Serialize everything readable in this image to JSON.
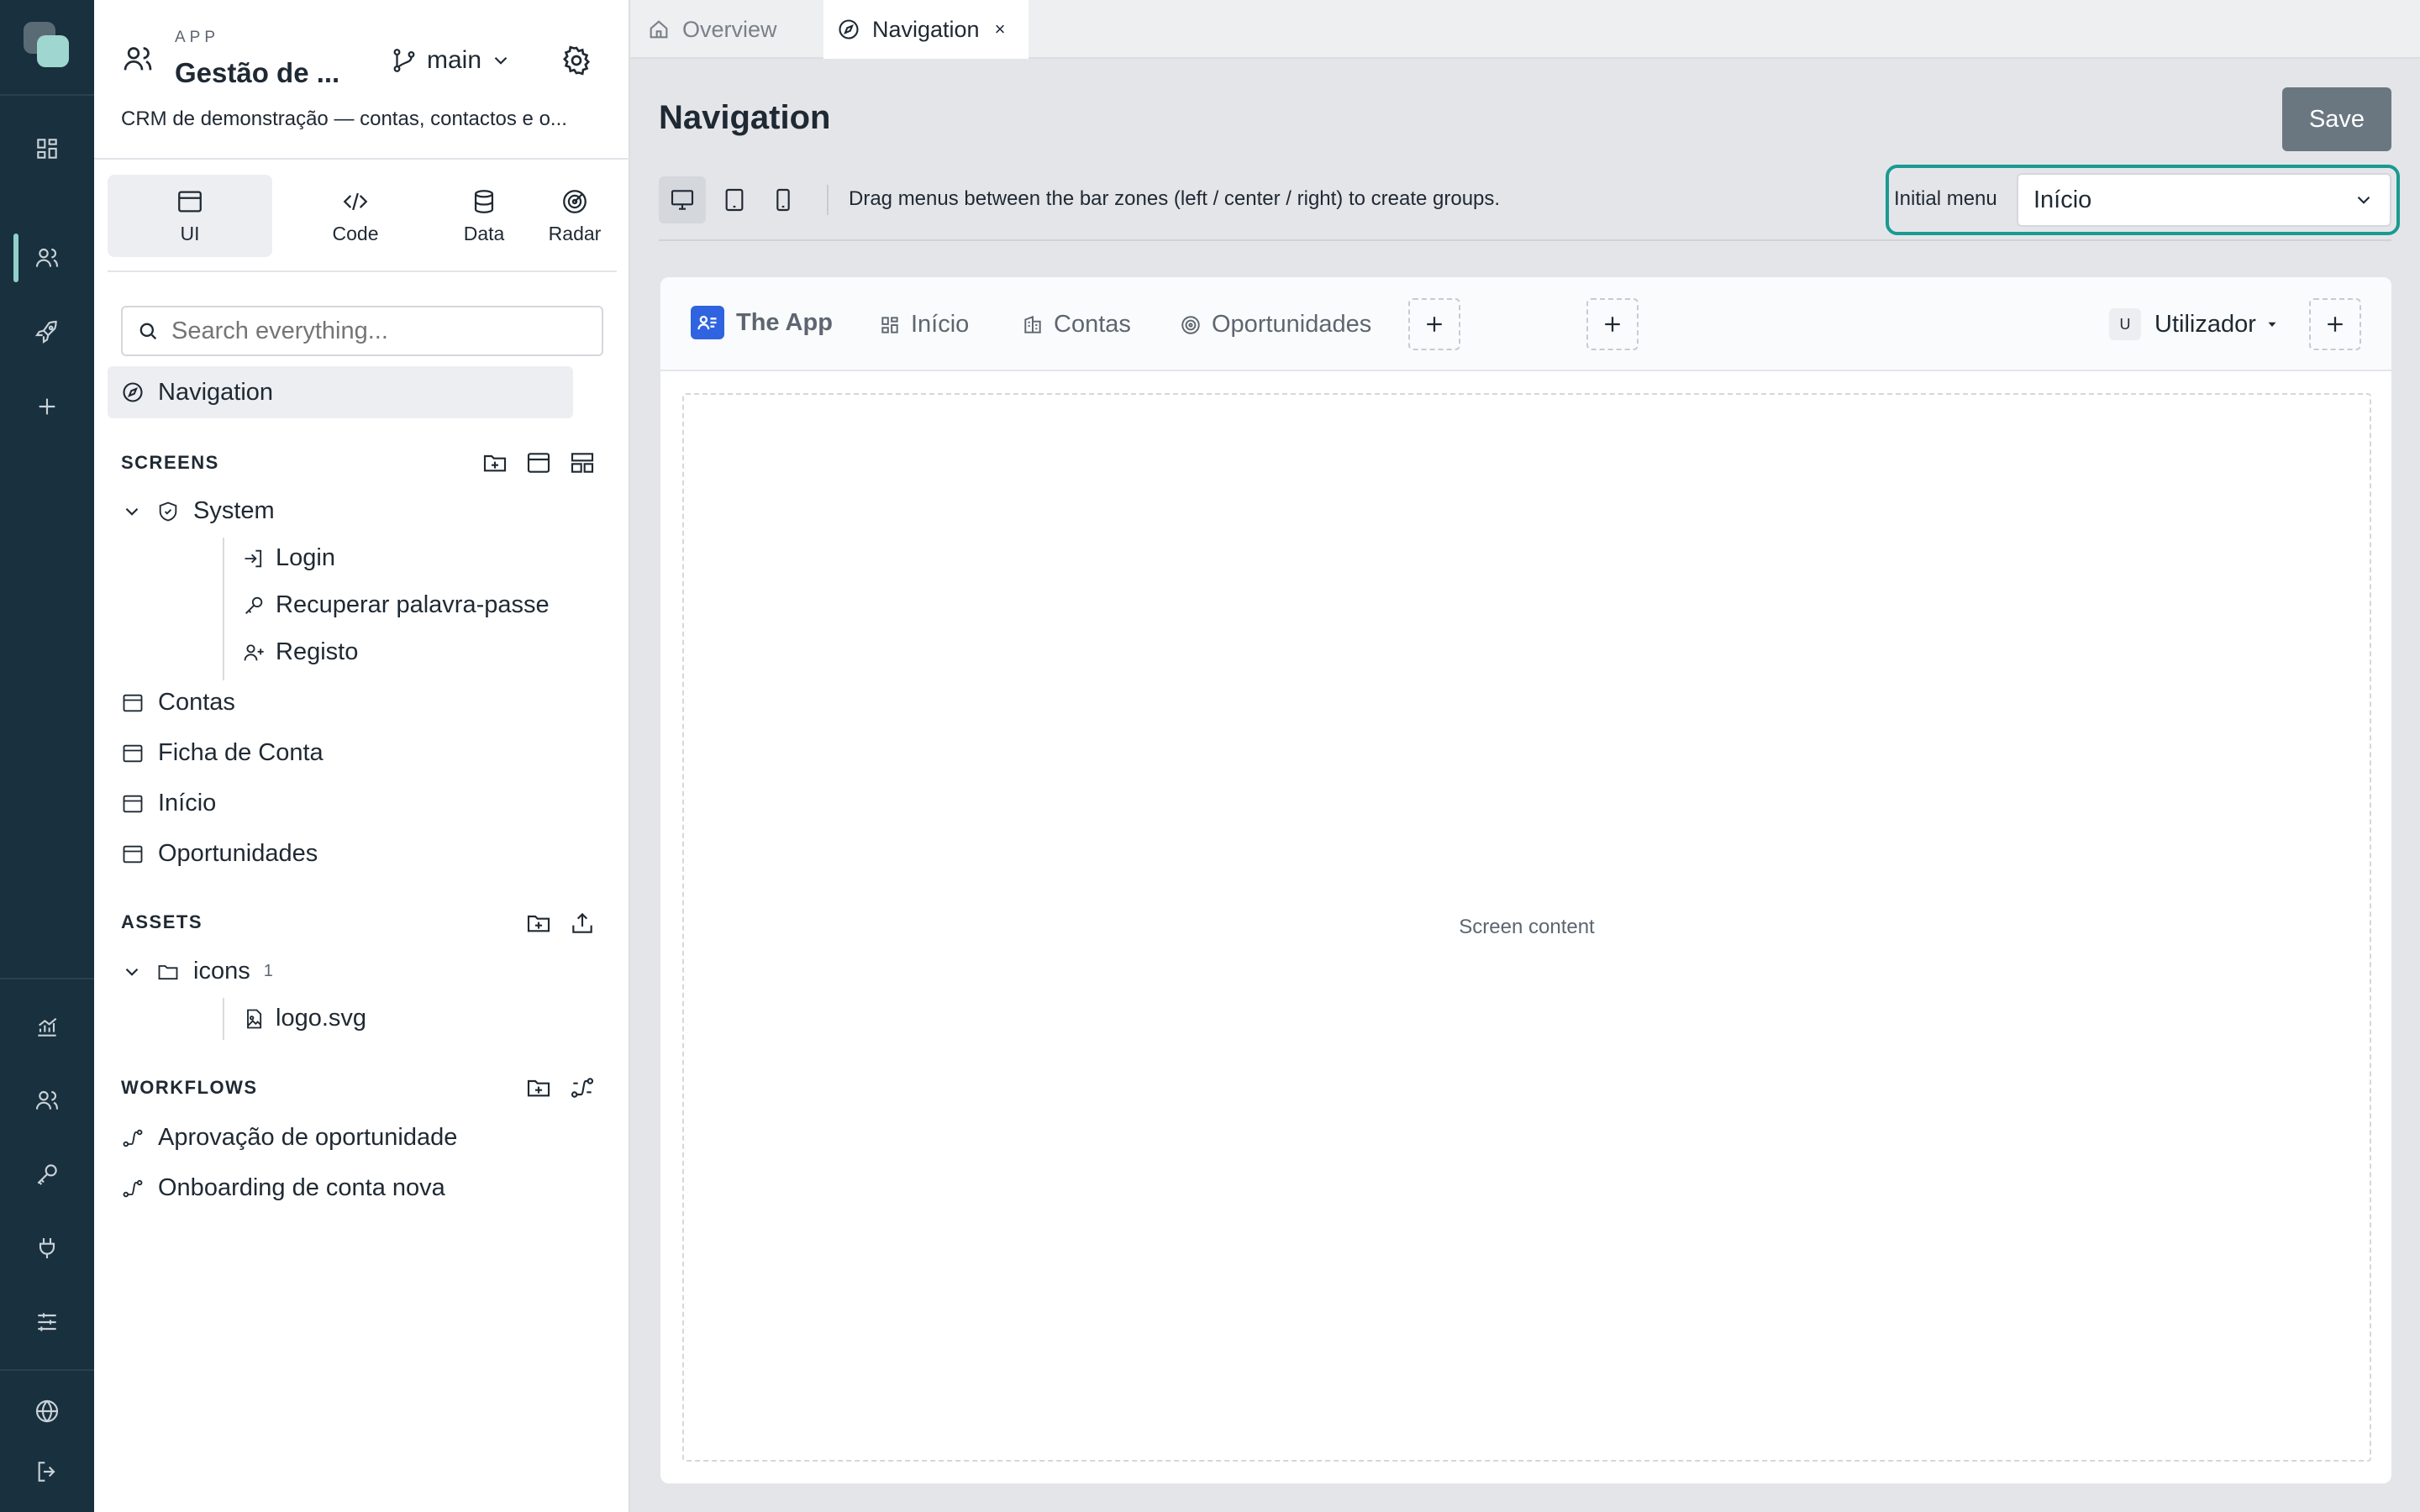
{
  "rail": {
    "icons": [
      "apps-grid-icon",
      "users-icon",
      "rocket-icon",
      "plus-icon",
      "analytics-icon",
      "team-icon",
      "key-icon",
      "plug-icon",
      "sliders-icon",
      "globe-icon",
      "logout-icon"
    ]
  },
  "app": {
    "kicker": "APP",
    "name": "Gestão de ...",
    "description": "CRM de demonstração — contas, contactos e o...",
    "branch": "main"
  },
  "mode_tabs": [
    {
      "label": "UI",
      "icon": "window-icon",
      "active": true
    },
    {
      "label": "Code",
      "icon": "code-icon",
      "active": false
    },
    {
      "label": "Data",
      "icon": "database-icon",
      "active": false
    },
    {
      "label": "Radar",
      "icon": "radar-icon",
      "active": false
    }
  ],
  "search": {
    "placeholder": "Search everything..."
  },
  "nav_item": {
    "label": "Navigation"
  },
  "screens": {
    "title": "SCREENS",
    "group": "System",
    "children": [
      "Login",
      "Recuperar palavra-passe",
      "Registo"
    ],
    "items": [
      "Contas",
      "Ficha de Conta",
      "Início",
      "Oportunidades"
    ]
  },
  "assets": {
    "title": "ASSETS",
    "folder": "icons",
    "folder_count": "1",
    "file": "logo.svg"
  },
  "workflows": {
    "title": "WORKFLOWS",
    "items": [
      "Aprovação de oportunidade",
      "Onboarding de conta nova"
    ]
  },
  "tabs": {
    "overview": "Overview",
    "navigation": "Navigation",
    "close": "×"
  },
  "page": {
    "title": "Navigation",
    "save": "Save",
    "hint": "Drag menus between the bar zones (left / center / right) to create groups.",
    "initial_menu_label": "Initial menu",
    "initial_menu_value": "Início"
  },
  "preview": {
    "brand": "The App",
    "menus": [
      "Início",
      "Contas",
      "Oportunidades"
    ],
    "user_initial": "U",
    "user": "Utilizador",
    "content": "Screen content"
  },
  "colors": {
    "rail": "#19303e",
    "accent": "#1a9a90",
    "save_bg": "#6b7780",
    "brand_blue": "#2f63e0"
  }
}
